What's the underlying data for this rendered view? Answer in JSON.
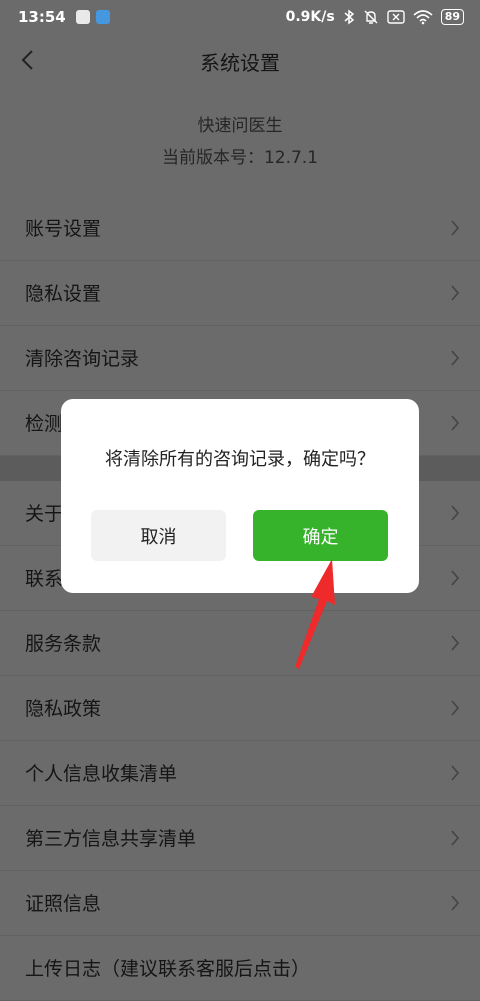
{
  "status": {
    "time": "13:54",
    "network_speed": "0.9K/s",
    "battery": "89"
  },
  "header": {
    "title": "系统设置"
  },
  "app_info": {
    "name": "快速问医生",
    "version": "当前版本号：12.7.1"
  },
  "menu": {
    "group1": [
      "账号设置",
      "隐私设置",
      "清除咨询记录",
      "检测"
    ],
    "group2": [
      "关于",
      "联系",
      "服务条款",
      "隐私政策",
      "个人信息收集清单",
      "第三方信息共享清单",
      "证照信息",
      "上传日志（建议联系客服后点击）"
    ]
  },
  "dialog": {
    "message": "将清除所有的咨询记录，确定吗？",
    "cancel_label": "取消",
    "confirm_label": "确定"
  },
  "colors": {
    "overlay": "#6b6b6b",
    "confirm_green": "#37b22b",
    "annotation_red": "#ee2a2a"
  },
  "icons": [
    "back-icon",
    "chevron-right-icon",
    "wifi-icon",
    "bluetooth-icon",
    "mute-icon",
    "battery-icon",
    "annotation-arrow"
  ]
}
